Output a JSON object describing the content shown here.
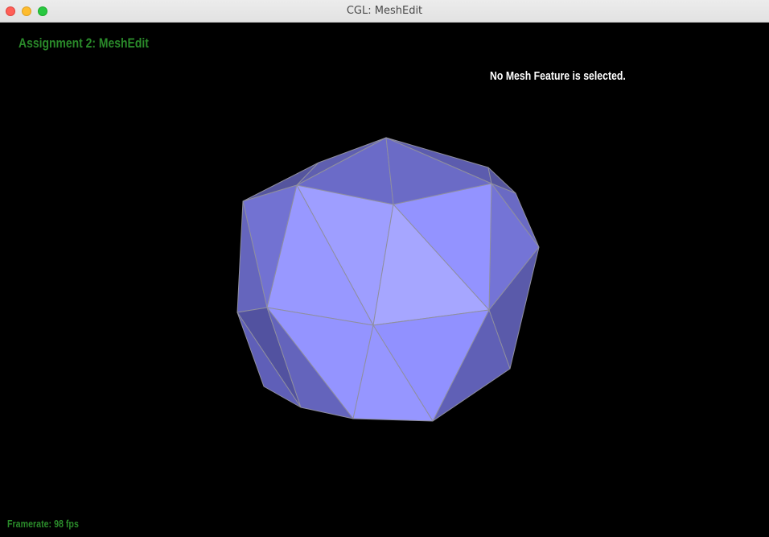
{
  "window": {
    "title": "CGL: MeshEdit"
  },
  "overlay": {
    "app_title": "Assignment 2: MeshEdit",
    "selection_status": "No Mesh Feature is selected.",
    "framerate": "Framerate: 98 fps"
  },
  "colors": {
    "background": "#000000",
    "app_title": "#2a8a2a",
    "status_text": "#ffffff",
    "mesh_front": "#9797ff",
    "mesh_side": "#6e6ec8",
    "mesh_edge": "#8f8f9f"
  },
  "mesh": {
    "icon": "icosahedron-mesh"
  }
}
